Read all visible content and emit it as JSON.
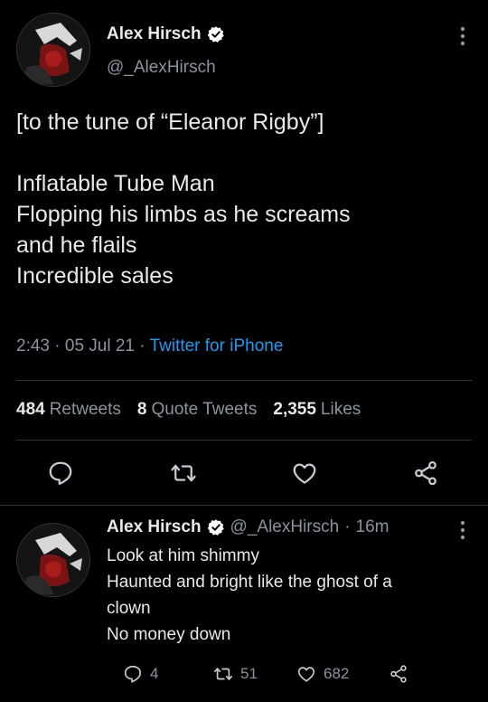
{
  "main_tweet": {
    "author": {
      "display_name": "Alex Hirsch",
      "handle": "@_AlexHirsch",
      "verified": true
    },
    "text_lines": [
      "[to the tune of “Eleanor Rigby”]",
      "",
      "Inflatable Tube Man",
      "Flopping his limbs as he screams",
      "and he flails",
      "Incredible sales"
    ],
    "time": "2:43",
    "date": "05 Jul 21",
    "source": "Twitter for iPhone",
    "stats": {
      "retweets_count": "484",
      "retweets_label": "Retweets",
      "quotes_count": "8",
      "quotes_label": "Quote Tweets",
      "likes_count": "2,355",
      "likes_label": "Likes"
    },
    "actions": [
      "reply-icon",
      "retweet-icon",
      "like-icon",
      "share-icon"
    ]
  },
  "reply_tweet": {
    "author": {
      "display_name": "Alex Hirsch",
      "handle": "@_AlexHirsch",
      "verified": true
    },
    "time_ago": "16m",
    "text_lines": [
      "Look at him shimmy",
      "Haunted and bright like the ghost of a",
      "clown",
      "No money down"
    ],
    "reply_count": "4",
    "retweet_count": "51",
    "like_count": "682"
  },
  "colors": {
    "background": "#000000",
    "text": "#e7e9ea",
    "secondary": "#8b949e",
    "link": "#1d9bf0",
    "verified_badge": "#ffffff"
  }
}
